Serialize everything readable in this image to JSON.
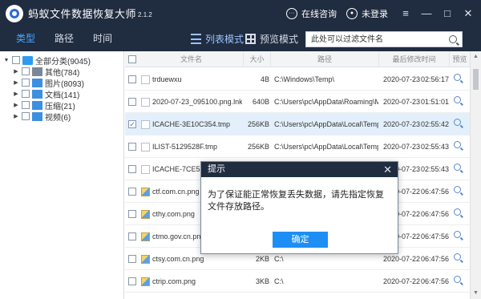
{
  "app": {
    "title": "蚂蚁文件数据恢复大师",
    "version": "2.1.2"
  },
  "titlebar": {
    "consult_label": "在线咨询",
    "login_label": "未登录",
    "menu_symbol": "≡",
    "minimize_symbol": "—",
    "maximize_symbol": "□",
    "close_symbol": "✕"
  },
  "toolbar": {
    "tabs": [
      {
        "label": "类型",
        "active": true
      },
      {
        "label": "路径",
        "active": false
      },
      {
        "label": "时间",
        "active": false
      }
    ],
    "list_mode_label": "列表模式",
    "preview_mode_label": "预览模式",
    "search_placeholder": "此处可以过滤文件名"
  },
  "tree": {
    "root": {
      "label": "全部分类(9045)"
    },
    "items": [
      {
        "label": "其他(784)",
        "icon": "other-folder-icon"
      },
      {
        "label": "图片(8093)",
        "icon": "image-folder-icon"
      },
      {
        "label": "文档(141)",
        "icon": "document-folder-icon"
      },
      {
        "label": "压缩(21)",
        "icon": "archive-folder-icon"
      },
      {
        "label": "视频(6)",
        "icon": "video-folder-icon"
      }
    ]
  },
  "table": {
    "columns": {
      "name": "文件名",
      "size": "大小",
      "path": "路径",
      "modified": "最后修改时间",
      "preview": "预览"
    },
    "rows": [
      {
        "name": "trduewxu",
        "size": "4B",
        "path": "C:\\Windows\\Temp\\",
        "date": "2020-07-23",
        "time": "02:56:17",
        "checked": false,
        "type": "file"
      },
      {
        "name": "2020-07-23_095100.png.lnk",
        "size": "640B",
        "path": "C:\\Users\\pc\\AppData\\Roaming\\Micro",
        "date": "2020-07-23",
        "time": "01:51:01",
        "checked": false,
        "type": "file"
      },
      {
        "name": "ICACHE-3E10C354.tmp",
        "size": "256KB",
        "path": "C:\\Users\\pc\\AppData\\Local\\Temp\\",
        "date": "2020-07-23",
        "time": "02:55:42",
        "checked": true,
        "type": "file"
      },
      {
        "name": "ILIST-5129528F.tmp",
        "size": "256KB",
        "path": "C:\\Users\\pc\\AppData\\Local\\Temp\\",
        "date": "2020-07-23",
        "time": "02:55:43",
        "checked": false,
        "type": "file"
      },
      {
        "name": "ICACHE-7CE51EDG",
        "size": "",
        "path": "",
        "date": "2020-07-23",
        "time": "02:55:43",
        "checked": false,
        "type": "file"
      },
      {
        "name": "ctf.com.cn.png",
        "size": "",
        "path": "",
        "date": "2020-07-22",
        "time": "06:47:56",
        "checked": false,
        "type": "image"
      },
      {
        "name": "cthy.com.png",
        "size": "",
        "path": "",
        "date": "2020-07-22",
        "time": "06:47:56",
        "checked": false,
        "type": "image"
      },
      {
        "name": "ctmo.gov.cn.png",
        "size": "",
        "path": "",
        "date": "2020-07-22",
        "time": "06:47:56",
        "checked": false,
        "type": "image"
      },
      {
        "name": "ctsy.com.cn.png",
        "size": "2KB",
        "path": "C:\\",
        "date": "2020-07-22",
        "time": "06:47:56",
        "checked": false,
        "type": "image"
      },
      {
        "name": "ctrip.com.png",
        "size": "3KB",
        "path": "C:\\",
        "date": "2020-07-22",
        "time": "06:47:56",
        "checked": false,
        "type": "image"
      }
    ]
  },
  "dialog": {
    "title": "提示",
    "message": "为了保证能正常恢复丢失数据，请先指定恢复文件存放路径。",
    "ok_label": "确定"
  },
  "colors": {
    "titlebar_bg": "#202c3f",
    "accent": "#4aa7ff",
    "button": "#1d8ef3",
    "selected_row": "#e3f0fc"
  }
}
